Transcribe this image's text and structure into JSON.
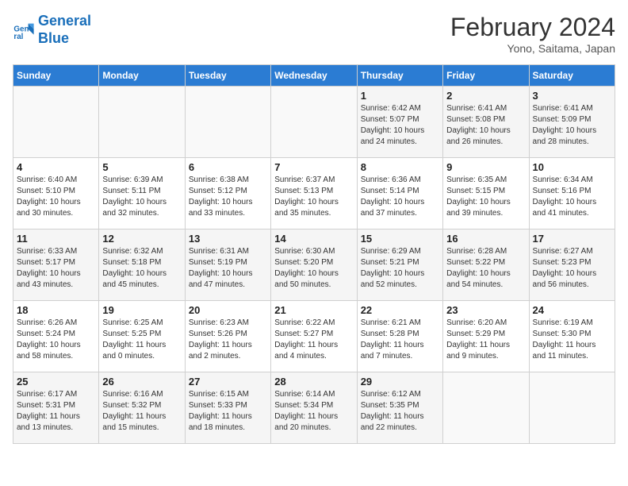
{
  "header": {
    "logo_line1": "General",
    "logo_line2": "Blue",
    "month": "February 2024",
    "location": "Yono, Saitama, Japan"
  },
  "days_of_week": [
    "Sunday",
    "Monday",
    "Tuesday",
    "Wednesday",
    "Thursday",
    "Friday",
    "Saturday"
  ],
  "weeks": [
    [
      {
        "day": "",
        "info": ""
      },
      {
        "day": "",
        "info": ""
      },
      {
        "day": "",
        "info": ""
      },
      {
        "day": "",
        "info": ""
      },
      {
        "day": "1",
        "info": "Sunrise: 6:42 AM\nSunset: 5:07 PM\nDaylight: 10 hours\nand 24 minutes."
      },
      {
        "day": "2",
        "info": "Sunrise: 6:41 AM\nSunset: 5:08 PM\nDaylight: 10 hours\nand 26 minutes."
      },
      {
        "day": "3",
        "info": "Sunrise: 6:41 AM\nSunset: 5:09 PM\nDaylight: 10 hours\nand 28 minutes."
      }
    ],
    [
      {
        "day": "4",
        "info": "Sunrise: 6:40 AM\nSunset: 5:10 PM\nDaylight: 10 hours\nand 30 minutes."
      },
      {
        "day": "5",
        "info": "Sunrise: 6:39 AM\nSunset: 5:11 PM\nDaylight: 10 hours\nand 32 minutes."
      },
      {
        "day": "6",
        "info": "Sunrise: 6:38 AM\nSunset: 5:12 PM\nDaylight: 10 hours\nand 33 minutes."
      },
      {
        "day": "7",
        "info": "Sunrise: 6:37 AM\nSunset: 5:13 PM\nDaylight: 10 hours\nand 35 minutes."
      },
      {
        "day": "8",
        "info": "Sunrise: 6:36 AM\nSunset: 5:14 PM\nDaylight: 10 hours\nand 37 minutes."
      },
      {
        "day": "9",
        "info": "Sunrise: 6:35 AM\nSunset: 5:15 PM\nDaylight: 10 hours\nand 39 minutes."
      },
      {
        "day": "10",
        "info": "Sunrise: 6:34 AM\nSunset: 5:16 PM\nDaylight: 10 hours\nand 41 minutes."
      }
    ],
    [
      {
        "day": "11",
        "info": "Sunrise: 6:33 AM\nSunset: 5:17 PM\nDaylight: 10 hours\nand 43 minutes."
      },
      {
        "day": "12",
        "info": "Sunrise: 6:32 AM\nSunset: 5:18 PM\nDaylight: 10 hours\nand 45 minutes."
      },
      {
        "day": "13",
        "info": "Sunrise: 6:31 AM\nSunset: 5:19 PM\nDaylight: 10 hours\nand 47 minutes."
      },
      {
        "day": "14",
        "info": "Sunrise: 6:30 AM\nSunset: 5:20 PM\nDaylight: 10 hours\nand 50 minutes."
      },
      {
        "day": "15",
        "info": "Sunrise: 6:29 AM\nSunset: 5:21 PM\nDaylight: 10 hours\nand 52 minutes."
      },
      {
        "day": "16",
        "info": "Sunrise: 6:28 AM\nSunset: 5:22 PM\nDaylight: 10 hours\nand 54 minutes."
      },
      {
        "day": "17",
        "info": "Sunrise: 6:27 AM\nSunset: 5:23 PM\nDaylight: 10 hours\nand 56 minutes."
      }
    ],
    [
      {
        "day": "18",
        "info": "Sunrise: 6:26 AM\nSunset: 5:24 PM\nDaylight: 10 hours\nand 58 minutes."
      },
      {
        "day": "19",
        "info": "Sunrise: 6:25 AM\nSunset: 5:25 PM\nDaylight: 11 hours\nand 0 minutes."
      },
      {
        "day": "20",
        "info": "Sunrise: 6:23 AM\nSunset: 5:26 PM\nDaylight: 11 hours\nand 2 minutes."
      },
      {
        "day": "21",
        "info": "Sunrise: 6:22 AM\nSunset: 5:27 PM\nDaylight: 11 hours\nand 4 minutes."
      },
      {
        "day": "22",
        "info": "Sunrise: 6:21 AM\nSunset: 5:28 PM\nDaylight: 11 hours\nand 7 minutes."
      },
      {
        "day": "23",
        "info": "Sunrise: 6:20 AM\nSunset: 5:29 PM\nDaylight: 11 hours\nand 9 minutes."
      },
      {
        "day": "24",
        "info": "Sunrise: 6:19 AM\nSunset: 5:30 PM\nDaylight: 11 hours\nand 11 minutes."
      }
    ],
    [
      {
        "day": "25",
        "info": "Sunrise: 6:17 AM\nSunset: 5:31 PM\nDaylight: 11 hours\nand 13 minutes."
      },
      {
        "day": "26",
        "info": "Sunrise: 6:16 AM\nSunset: 5:32 PM\nDaylight: 11 hours\nand 15 minutes."
      },
      {
        "day": "27",
        "info": "Sunrise: 6:15 AM\nSunset: 5:33 PM\nDaylight: 11 hours\nand 18 minutes."
      },
      {
        "day": "28",
        "info": "Sunrise: 6:14 AM\nSunset: 5:34 PM\nDaylight: 11 hours\nand 20 minutes."
      },
      {
        "day": "29",
        "info": "Sunrise: 6:12 AM\nSunset: 5:35 PM\nDaylight: 11 hours\nand 22 minutes."
      },
      {
        "day": "",
        "info": ""
      },
      {
        "day": "",
        "info": ""
      }
    ]
  ]
}
